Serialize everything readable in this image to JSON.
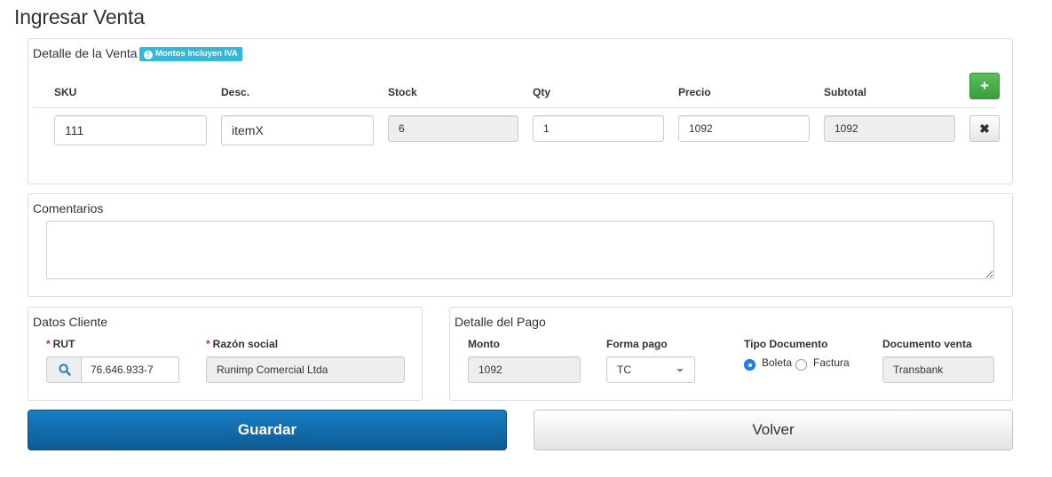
{
  "page": {
    "title": "Ingresar Venta"
  },
  "detalle_venta": {
    "title": "Detalle de la Venta",
    "badge": "Montos Incluyen IVA",
    "badge_icon": "info-circle-icon",
    "columns": [
      "SKU",
      "Desc.",
      "Stock",
      "Qty",
      "Precio",
      "Subtotal"
    ],
    "add_icon": "plus-icon",
    "remove_icon": "times-icon",
    "rows": [
      {
        "sku": "111",
        "desc": "itemX",
        "stock": "6",
        "qty": "1",
        "precio": "1092",
        "subtotal": "1092"
      }
    ]
  },
  "comentarios": {
    "title": "Comentarios",
    "value": ""
  },
  "datos_cliente": {
    "title": "Datos Cliente",
    "rut_label": "RUT",
    "rut_value": "76.646.933-7",
    "search_icon": "search-icon",
    "razon_label": "Razón social",
    "razon_value": "Runimp Comercial Ltda",
    "required_mark": "*"
  },
  "detalle_pago": {
    "title": "Detalle del Pago",
    "monto_label": "Monto",
    "monto_value": "1092",
    "forma_label": "Forma pago",
    "forma_value": "TC",
    "tipo_label": "Tipo Documento",
    "tipo_options": [
      "Boleta",
      "Factura"
    ],
    "tipo_selected": "Boleta",
    "doc_label": "Documento venta",
    "doc_value": "Transbank"
  },
  "actions": {
    "save_label": "Guardar",
    "back_label": "Volver"
  },
  "colors": {
    "primary": "#1a7fc4",
    "success": "#3a9e3a",
    "info": "#31b9d6",
    "required": "#c9302c"
  }
}
